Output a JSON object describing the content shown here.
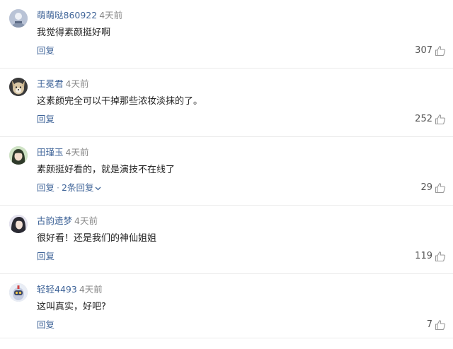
{
  "comments": [
    {
      "username": "萌萌哒860922",
      "time": "4天前",
      "text": "我觉得素颜挺好啊",
      "reply_label": "回复",
      "sub_replies": "",
      "likes": "307"
    },
    {
      "username": "王冕君",
      "time": "4天前",
      "text": "这素颜完全可以干掉那些浓妆淡抹的了。",
      "reply_label": "回复",
      "sub_replies": "",
      "likes": "252"
    },
    {
      "username": "田瑾玉",
      "time": "4天前",
      "text": "素颜挺好看的，就是演技不在线了",
      "reply_label": "回复",
      "sub_replies": "2条回复",
      "likes": "29"
    },
    {
      "username": "古韵遗梦",
      "time": "4天前",
      "text": "很好看！还是我们的神仙姐姐",
      "reply_label": "回复",
      "sub_replies": "",
      "likes": "119"
    },
    {
      "username": "轻轻4493",
      "time": "4天前",
      "text": "这叫真实，好吧?",
      "reply_label": "回复",
      "sub_replies": "",
      "likes": "7"
    }
  ],
  "colors": {
    "username": "#406599",
    "action_link": "#406599",
    "timestamp": "#888888",
    "divider": "#ebebeb"
  },
  "icons": {
    "like": "thumbs-up-outline-icon",
    "expand": "chevron-down-icon"
  }
}
